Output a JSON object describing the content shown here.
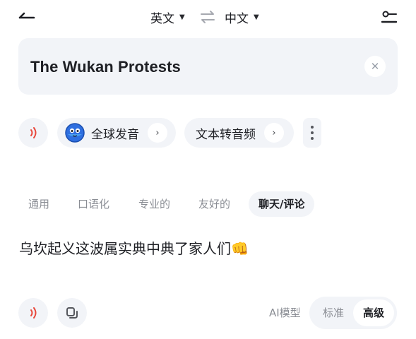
{
  "header": {
    "source_language": "英文",
    "target_language": "中文"
  },
  "input": {
    "text": "The Wukan Protests",
    "clear_icon": "close-icon"
  },
  "tools": {
    "global_pronunciation_label": "全球发音",
    "text_to_audio_label": "文本转音频"
  },
  "style_tabs": [
    {
      "label": "通用",
      "active": false
    },
    {
      "label": "口语化",
      "active": false
    },
    {
      "label": "专业的",
      "active": false
    },
    {
      "label": "友好的",
      "active": false
    },
    {
      "label": "聊天/评论",
      "active": true
    }
  ],
  "result": {
    "text": "乌坎起义这波属实典中典了家人们👊"
  },
  "footer": {
    "ai_model_label": "AI模型",
    "model_options": [
      {
        "label": "标准",
        "selected": false
      },
      {
        "label": "高级",
        "selected": true
      }
    ]
  },
  "colors": {
    "accent_red": "#e8473b",
    "panel_gray": "#f2f4f8",
    "text_dark": "#1e1f24",
    "text_muted": "#8a8d94"
  }
}
